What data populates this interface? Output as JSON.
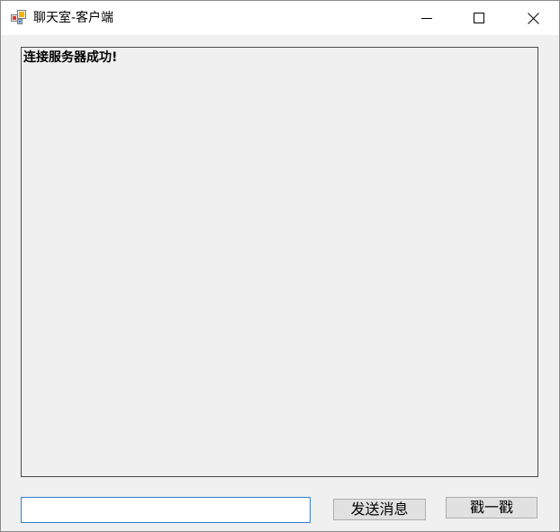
{
  "window": {
    "title": "聊天室-客户端",
    "controls": {
      "minimize": "minimize-icon",
      "maximize": "maximize-icon",
      "close": "close-icon"
    }
  },
  "log": {
    "lines": [
      "连接服务器成功!"
    ]
  },
  "compose": {
    "input_value": "",
    "send_label": "发送消息",
    "poke_label": "戳一戳"
  },
  "colors": {
    "window_bg": "#f0f0f0",
    "titlebar_bg": "#ffffff",
    "input_border": "#2f7fd2",
    "button_bg": "#e1e1e1"
  }
}
